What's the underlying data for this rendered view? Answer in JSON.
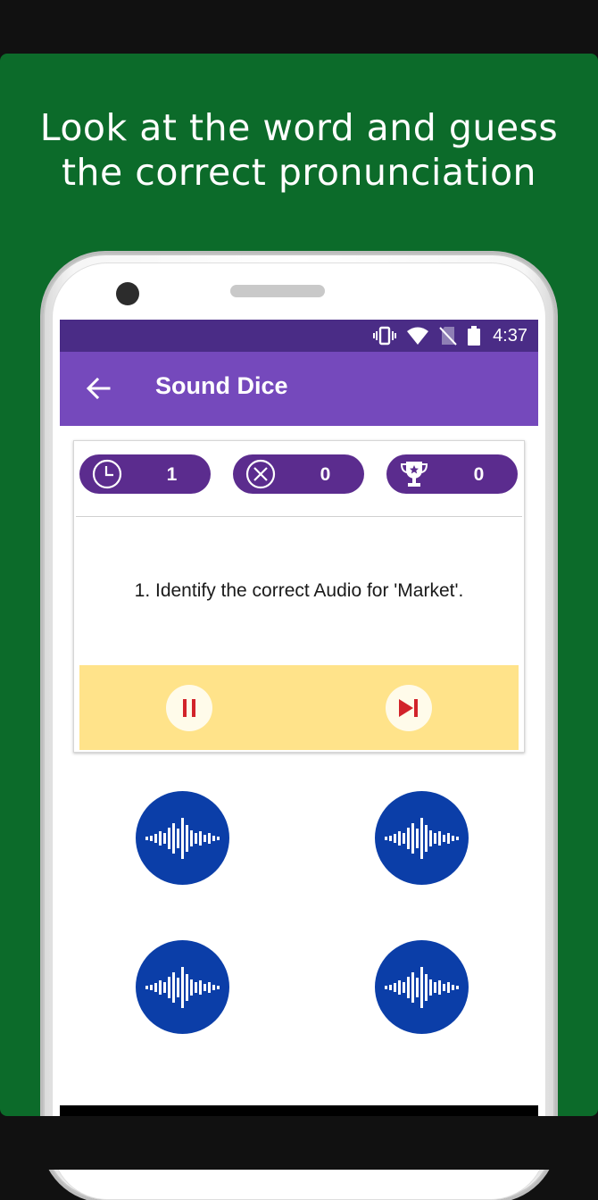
{
  "promo": {
    "headline_line1": "Look at the word and guess",
    "headline_line2": "the correct pronunciation",
    "background_color": "#0c6b2a"
  },
  "status_bar": {
    "time": "4:37",
    "icons": [
      "vibrate-icon",
      "wifi-icon",
      "no-sim-icon",
      "battery-icon"
    ]
  },
  "app_bar": {
    "back_icon": "arrow-left-icon",
    "title": "Sound Dice",
    "color": "#7549bc"
  },
  "stats": [
    {
      "icon": "clock-icon",
      "value": "1"
    },
    {
      "icon": "x-circle-icon",
      "value": "0"
    },
    {
      "icon": "trophy-icon",
      "value": "0"
    }
  ],
  "question": {
    "text": "1. Identify the correct Audio for 'Market'."
  },
  "controls": {
    "pause_icon": "pause-icon",
    "next_icon": "skip-next-icon",
    "bar_color": "#ffe38a"
  },
  "audio_options": [
    {
      "icon": "sound-wave-icon"
    },
    {
      "icon": "sound-wave-icon"
    },
    {
      "icon": "sound-wave-icon"
    },
    {
      "icon": "sound-wave-icon"
    }
  ]
}
